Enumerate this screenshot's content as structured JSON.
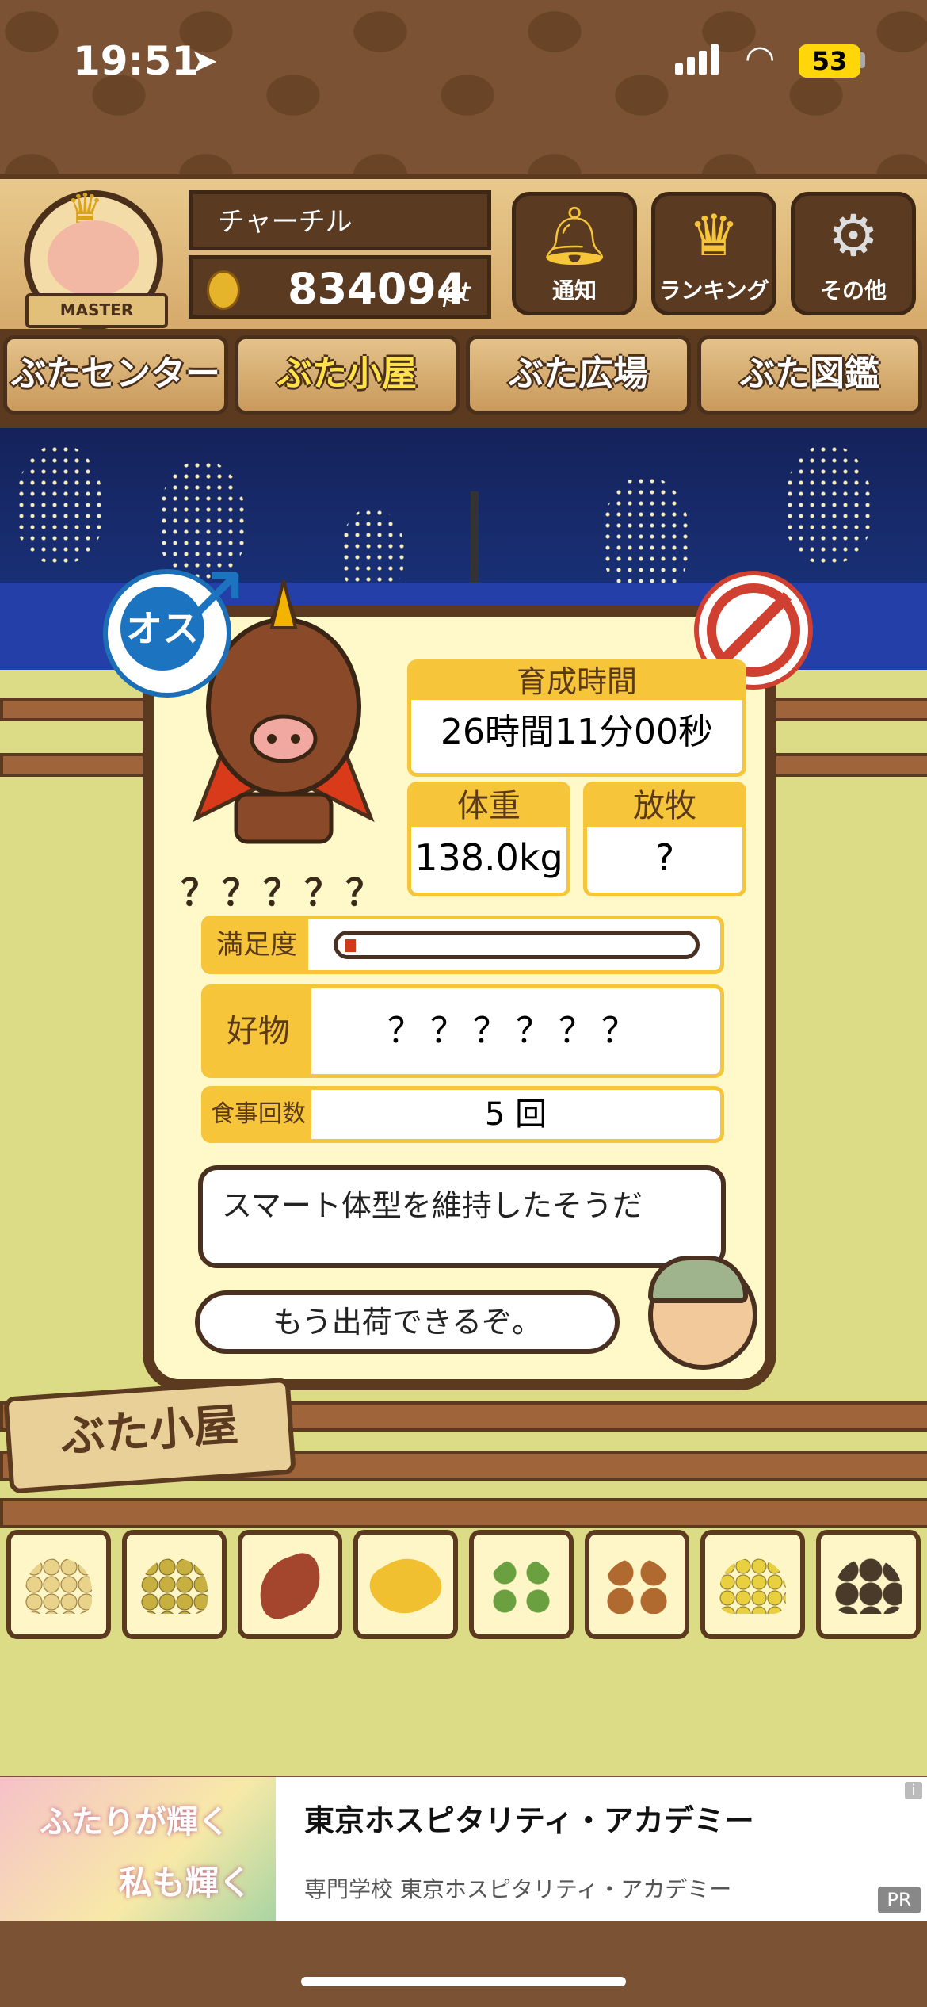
{
  "status": {
    "time": "19:51",
    "battery": "53"
  },
  "user": {
    "rank": "MASTER",
    "name": "チャーチル",
    "points": "834094",
    "points_unit": "pt"
  },
  "header_buttons": [
    {
      "icon": "bell-icon",
      "label": "通知"
    },
    {
      "icon": "crown-icon",
      "label": "ランキング"
    },
    {
      "icon": "gear-icon",
      "label": "その他"
    }
  ],
  "nav_tabs": [
    "ぶたセンター",
    "ぶた小屋",
    "ぶた広場",
    "ぶた図鑑"
  ],
  "active_tab": "ぶた小屋",
  "pig": {
    "gender": "オス",
    "name": "？？？？？",
    "growth_label": "育成時間",
    "growth_value": "26時間11分00秒",
    "weight_label": "体重",
    "weight_value": "138.0kg",
    "graze_label": "放牧",
    "graze_value": "?",
    "satisfaction_label": "満足度",
    "satisfaction_level": 0.03,
    "favorite_label": "好物",
    "favorite_value": "？？？？？？",
    "meals_label": "食事回数",
    "meals_value": "5 回",
    "message": "スマート体型を維持したそうだ",
    "farmer_message": "もう出荷できるぞ。"
  },
  "sign": "ぶた小屋",
  "foods": [
    "feed-pellets-icon",
    "mixed-grain-icon",
    "sweet-potato-icon",
    "corn-icon",
    "plant-icon",
    "acorn-icon",
    "soybean-icon",
    "truffle-icon"
  ],
  "ad": {
    "image_text_1": "ふたりが輝く",
    "image_text_2": "私も輝く",
    "title": "東京ホスピタリティ・アカデミー",
    "subtitle": "専門学校 東京ホスピタリティ・アカデミー",
    "badge": "PR",
    "info": "i"
  },
  "colors": {
    "accent": "#f6c53a",
    "wood": "#5b3a1f",
    "male": "#1c74c0",
    "forbidden": "#d04030"
  }
}
